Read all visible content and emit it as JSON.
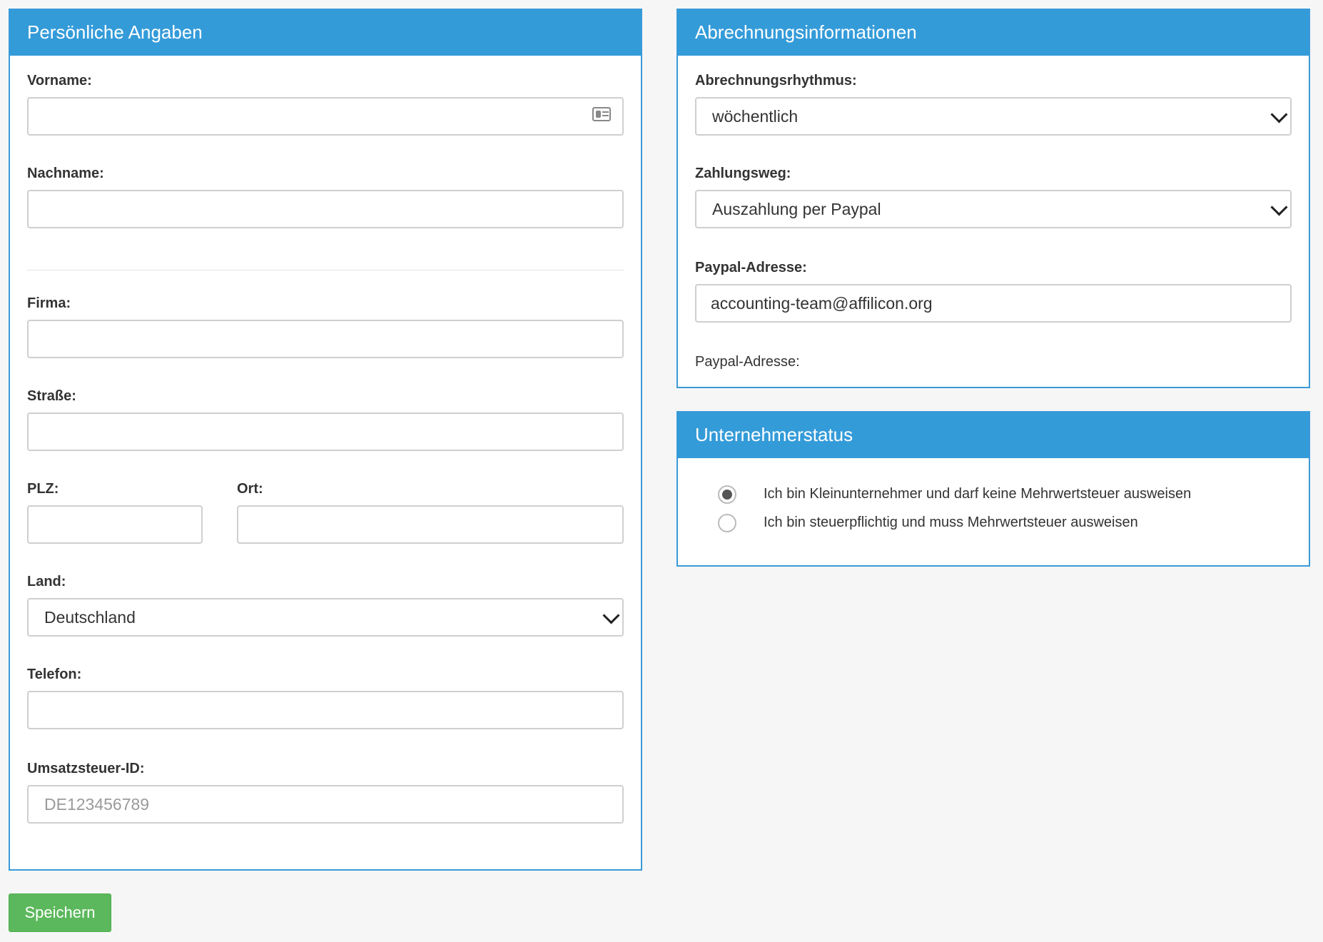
{
  "personal": {
    "title": "Persönliche Angaben",
    "vorname": {
      "label": "Vorname:",
      "value": "",
      "placeholder": ""
    },
    "nachname": {
      "label": "Nachname:",
      "value": "",
      "placeholder": ""
    },
    "firma": {
      "label": "Firma:",
      "value": "",
      "placeholder": ""
    },
    "strasse": {
      "label": "Straße:",
      "value": "",
      "placeholder": ""
    },
    "plz": {
      "label": "PLZ:",
      "value": "",
      "placeholder": ""
    },
    "ort": {
      "label": "Ort:",
      "value": "",
      "placeholder": ""
    },
    "land": {
      "label": "Land:",
      "selected": "Deutschland"
    },
    "telefon": {
      "label": "Telefon:",
      "value": "",
      "placeholder": ""
    },
    "ust_id": {
      "label": "Umsatzsteuer-ID:",
      "value": "",
      "placeholder": "DE123456789"
    }
  },
  "billing": {
    "title": "Abrechnungsinformationen",
    "rhythm": {
      "label": "Abrechnungsrhythmus:",
      "selected": "wöchentlich"
    },
    "payment": {
      "label": "Zahlungsweg:",
      "selected": "Auszahlung per Paypal"
    },
    "paypal": {
      "label": "Paypal-Adresse:",
      "value": "accounting-team@affilicon.org"
    },
    "paypal_info_label": "Paypal-Adresse:"
  },
  "status": {
    "title": "Unternehmerstatus",
    "options": [
      {
        "label": "Ich bin Kleinunternehmer und darf keine Mehrwertsteuer ausweisen",
        "checked": true
      },
      {
        "label": "Ich bin steuerpflichtig und muss Mehrwertsteuer ausweisen",
        "checked": false
      }
    ]
  },
  "actions": {
    "save_label": "Speichern"
  },
  "icons": {
    "vorname_field": "contact-card-icon",
    "select_arrow": "chevron-down-icon"
  },
  "colors": {
    "header": "#349bd9",
    "panel_border": "#3a9ad9",
    "save_button": "#5cb85c"
  }
}
